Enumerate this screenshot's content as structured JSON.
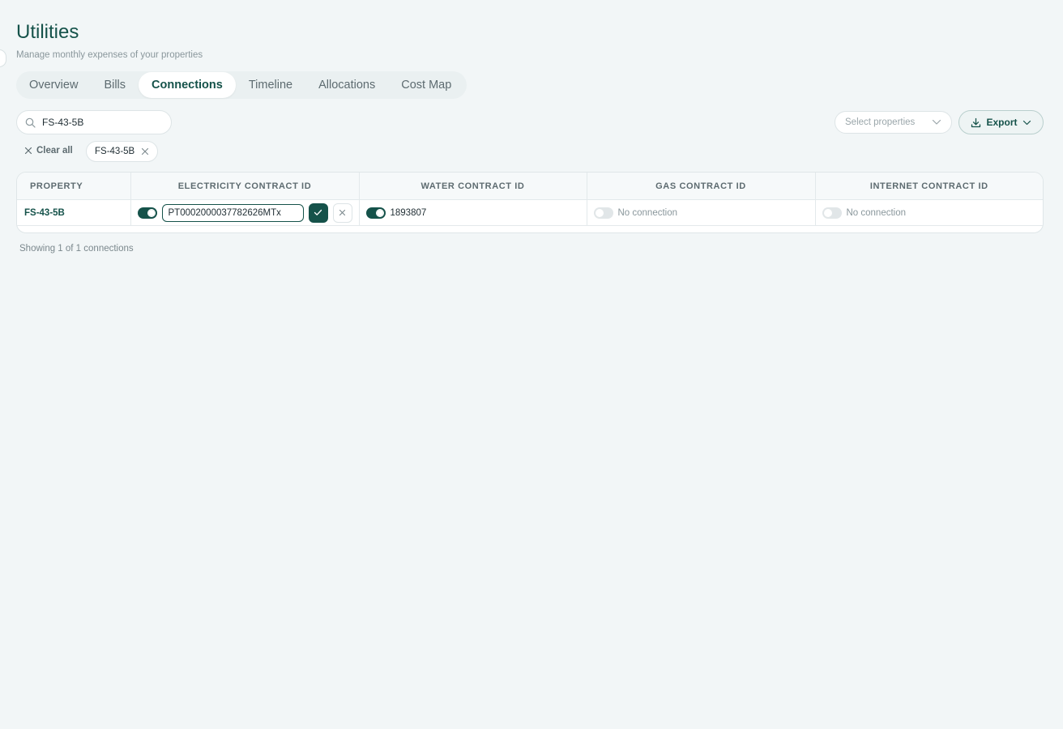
{
  "header": {
    "title": "Utilities",
    "subtitle": "Manage monthly expenses of your properties"
  },
  "tabs": [
    {
      "label": "Overview",
      "active": false
    },
    {
      "label": "Bills",
      "active": false
    },
    {
      "label": "Connections",
      "active": true
    },
    {
      "label": "Timeline",
      "active": false
    },
    {
      "label": "Allocations",
      "active": false
    },
    {
      "label": "Cost Map",
      "active": false
    }
  ],
  "toolbar": {
    "search_value": "FS-43-5B",
    "select_properties_placeholder": "Select properties",
    "export_label": "Export"
  },
  "filters": {
    "clear_all_label": "Clear all",
    "chips": [
      "FS-43-5B"
    ]
  },
  "table": {
    "columns": [
      "PROPERTY",
      "ELECTRICITY CONTRACT ID",
      "WATER CONTRACT ID",
      "GAS CONTRACT ID",
      "INTERNET CONTRACT ID"
    ],
    "rows": [
      {
        "property": "FS-43-5B",
        "electricity": {
          "enabled": true,
          "editing": true,
          "value": "PT0002000037782626MTx"
        },
        "water": {
          "enabled": true,
          "value": "1893807"
        },
        "gas": {
          "enabled": false,
          "value": "No connection"
        },
        "internet": {
          "enabled": false,
          "value": "No connection"
        }
      }
    ]
  },
  "footer": {
    "count_text": "Showing 1 of 1 connections"
  },
  "colors": {
    "accent": "#15524a",
    "background": "#f2f6f7",
    "muted_text": "#8a979c"
  },
  "icons": {
    "search": "search-icon",
    "chevron": "chevron-down-icon",
    "download": "download-icon",
    "close": "close-icon",
    "check": "check-icon"
  }
}
